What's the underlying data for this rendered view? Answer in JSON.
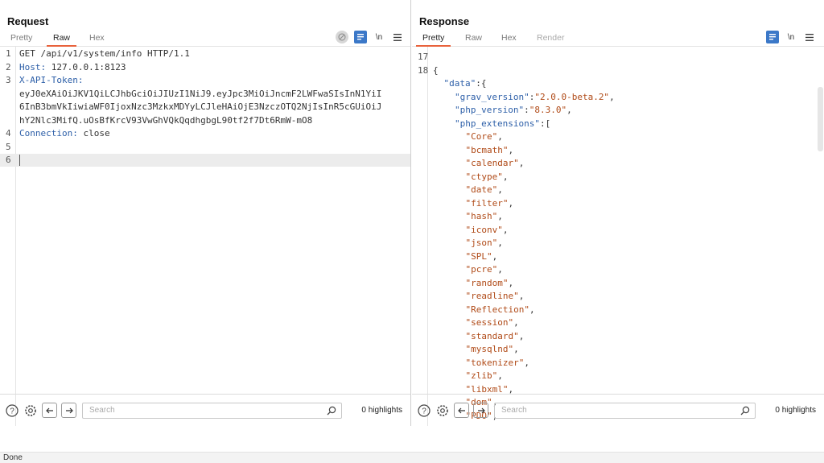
{
  "layout_toggle": {
    "active": "side-by-side"
  },
  "request": {
    "title": "Request",
    "tabs": [
      {
        "label": "Pretty",
        "state": "normal"
      },
      {
        "label": "Raw",
        "state": "active"
      },
      {
        "label": "Hex",
        "state": "normal"
      }
    ],
    "lines": [
      {
        "n": "1",
        "text": "GET /api/v1/system/info HTTP/1.1"
      },
      {
        "n": "2",
        "key": "Host:",
        "text": " 127.0.0.1:8123"
      },
      {
        "n": "3",
        "key": "X-API-Token:",
        "text": ""
      },
      {
        "n": "",
        "text": "eyJ0eXAiOiJKV1QiLCJhbGciOiJIUzI1NiJ9.eyJpc3MiOiJncmF2LWFwaSIsInN1YiI"
      },
      {
        "n": "",
        "text": "6InB3bmVkIiwiaWF0IjoxNzc3MzkxMDYyLCJleHAiOjE3NzczOTQ2NjIsInR5cGUiOiJ"
      },
      {
        "n": "",
        "text": "hY2Nlc3MifQ.uOsBfKrcV93VwGhVQkQqdhgbgL90tf2f7Dt6RmW-mO8"
      },
      {
        "n": "4",
        "key": "Connection:",
        "text": " close"
      },
      {
        "n": "5",
        "text": ""
      },
      {
        "n": "6",
        "text": ""
      }
    ],
    "search": {
      "placeholder": "Search"
    },
    "highlights": "0 highlights"
  },
  "response": {
    "title": "Response",
    "tabs": [
      {
        "label": "Pretty",
        "state": "active"
      },
      {
        "label": "Raw",
        "state": "normal"
      },
      {
        "label": "Hex",
        "state": "normal"
      },
      {
        "label": "Render",
        "state": "disabled"
      }
    ],
    "lines": [
      {
        "n": "17",
        "text": ""
      },
      {
        "n": "18",
        "text": "{"
      },
      {
        "n": "",
        "indent": 1,
        "key": "\"data\"",
        "text": ":{"
      },
      {
        "n": "",
        "indent": 2,
        "key": "\"grav_version\"",
        "str": "\"2.0.0-beta.2\"",
        "text": ","
      },
      {
        "n": "",
        "indent": 2,
        "key": "\"php_version\"",
        "str": "\"8.3.0\"",
        "text": ","
      },
      {
        "n": "",
        "indent": 2,
        "key": "\"php_extensions\"",
        "text": ":["
      },
      {
        "n": "",
        "indent": 3,
        "str": "\"Core\"",
        "text": ","
      },
      {
        "n": "",
        "indent": 3,
        "str": "\"bcmath\"",
        "text": ","
      },
      {
        "n": "",
        "indent": 3,
        "str": "\"calendar\"",
        "text": ","
      },
      {
        "n": "",
        "indent": 3,
        "str": "\"ctype\"",
        "text": ","
      },
      {
        "n": "",
        "indent": 3,
        "str": "\"date\"",
        "text": ","
      },
      {
        "n": "",
        "indent": 3,
        "str": "\"filter\"",
        "text": ","
      },
      {
        "n": "",
        "indent": 3,
        "str": "\"hash\"",
        "text": ","
      },
      {
        "n": "",
        "indent": 3,
        "str": "\"iconv\"",
        "text": ","
      },
      {
        "n": "",
        "indent": 3,
        "str": "\"json\"",
        "text": ","
      },
      {
        "n": "",
        "indent": 3,
        "str": "\"SPL\"",
        "text": ","
      },
      {
        "n": "",
        "indent": 3,
        "str": "\"pcre\"",
        "text": ","
      },
      {
        "n": "",
        "indent": 3,
        "str": "\"random\"",
        "text": ","
      },
      {
        "n": "",
        "indent": 3,
        "str": "\"readline\"",
        "text": ","
      },
      {
        "n": "",
        "indent": 3,
        "str": "\"Reflection\"",
        "text": ","
      },
      {
        "n": "",
        "indent": 3,
        "str": "\"session\"",
        "text": ","
      },
      {
        "n": "",
        "indent": 3,
        "str": "\"standard\"",
        "text": ","
      },
      {
        "n": "",
        "indent": 3,
        "str": "\"mysqlnd\"",
        "text": ","
      },
      {
        "n": "",
        "indent": 3,
        "str": "\"tokenizer\"",
        "text": ","
      },
      {
        "n": "",
        "indent": 3,
        "str": "\"zlib\"",
        "text": ","
      },
      {
        "n": "",
        "indent": 3,
        "str": "\"libxml\"",
        "text": ","
      },
      {
        "n": "",
        "indent": 3,
        "str": "\"dom\"",
        "text": ","
      },
      {
        "n": "",
        "indent": 3,
        "str": "\"PDO\"",
        "text": ","
      }
    ],
    "search": {
      "placeholder": "Search"
    },
    "highlights": "0 highlights"
  },
  "status": {
    "text": "Done"
  }
}
